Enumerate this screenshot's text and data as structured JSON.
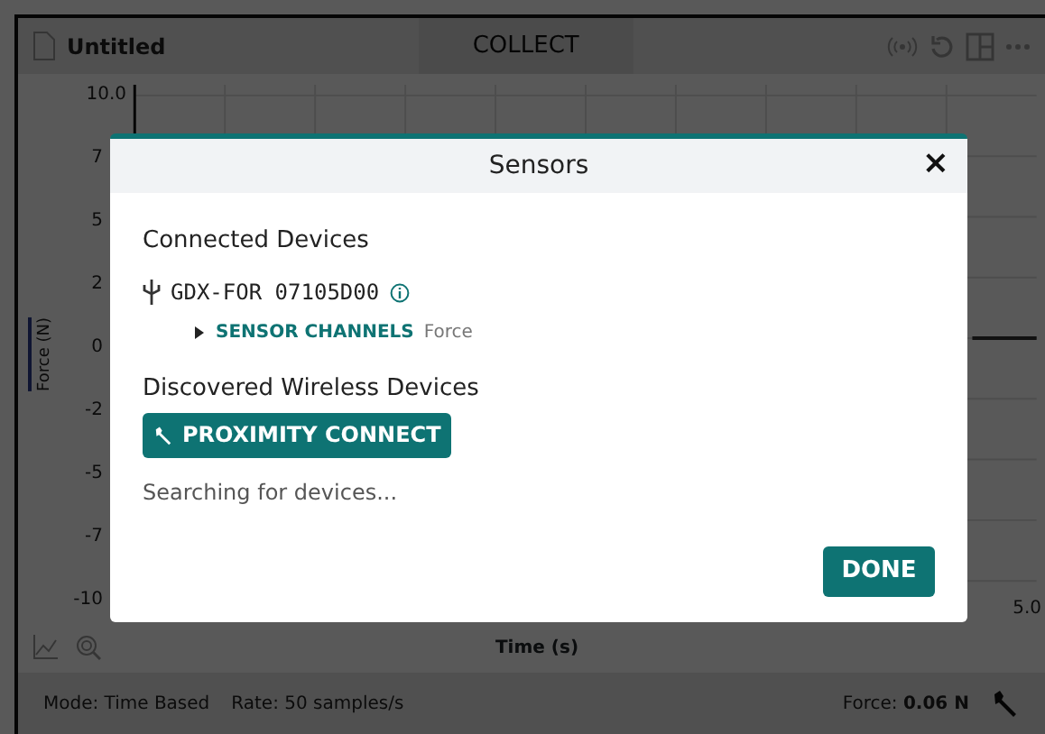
{
  "toolbar": {
    "file_name": "Untitled",
    "mode_button": "COLLECT"
  },
  "graph": {
    "y_axis_label": "Force (N)",
    "y_tick_labels": [
      "10.0",
      "7",
      "5",
      "2",
      "0",
      "-2",
      "-5",
      "-7",
      "-10"
    ],
    "x_tick_label": "5.0",
    "x_axis_label": "Time (s)"
  },
  "status_bar": {
    "mode": "Mode: Time Based",
    "rate": "Rate: 50 samples/s",
    "reading_label": "Force:",
    "reading_value": "0.06 N"
  },
  "dialog": {
    "title": "Sensors",
    "close": "×",
    "connected_heading": "Connected Devices",
    "devices": [
      {
        "name": "GDX-FOR 07105D00",
        "channels_label": "SENSOR CHANNELS",
        "channels": "Force",
        "expanded": false
      }
    ],
    "wireless_heading": "Discovered Wireless Devices",
    "connect_button": "PROXIMITY CONNECT",
    "status_text": "Searching for devices...",
    "done_button": "DONE"
  }
}
